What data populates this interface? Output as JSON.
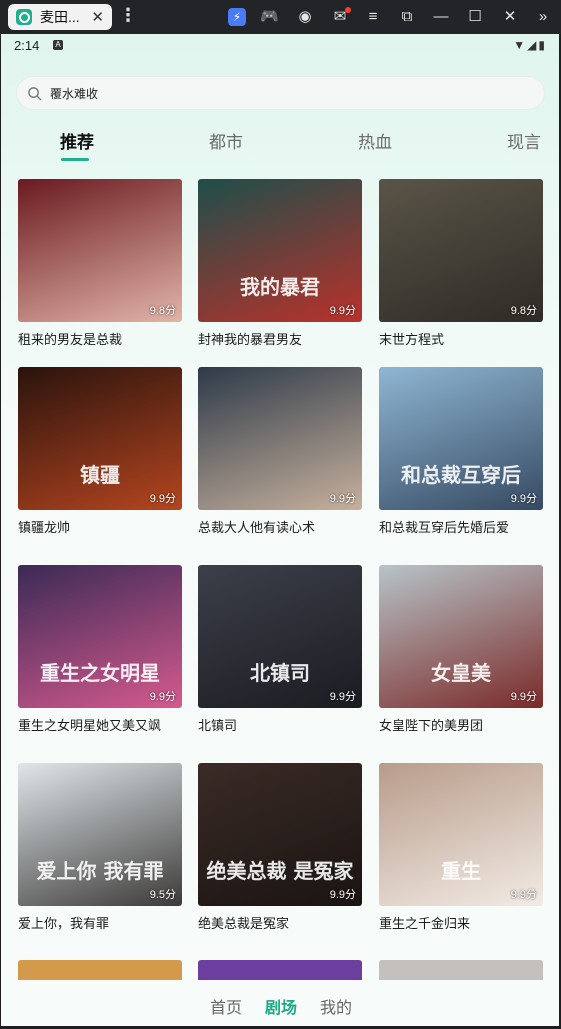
{
  "window": {
    "tab_title": "麦田...",
    "close_symbol": "✕",
    "menu_symbol": "⋮",
    "toolbar_icons": [
      "bolt-icon",
      "gamepad-icon",
      "user-icon",
      "mail-icon",
      "menu-icon",
      "external-icon",
      "minimize-icon",
      "maximize-icon",
      "close-icon",
      "chevron-right-icon"
    ],
    "toolbar_glyphs": [
      "⚡",
      "🎮",
      "◉",
      "✉",
      "≡",
      "⧉",
      "—",
      "☐",
      "✕",
      "»"
    ]
  },
  "status_bar": {
    "time": "2:14",
    "indicator": "A",
    "right_icons": "▼◢▮"
  },
  "search": {
    "text": "覆水难收"
  },
  "tabs": [
    {
      "label": "推荐",
      "active": true
    },
    {
      "label": "都市",
      "active": false
    },
    {
      "label": "热血",
      "active": false
    },
    {
      "label": "现言",
      "active": false
    }
  ],
  "cards": [
    {
      "title": "租来的男友是总裁",
      "score": "9.8分",
      "colors": [
        "#6a1a1f",
        "#e2b4a8"
      ],
      "poster": ""
    },
    {
      "title": "封神我的暴君男友",
      "score": "9.9分",
      "colors": [
        "#1f4e4a",
        "#b9312b"
      ],
      "poster": "我的暴君"
    },
    {
      "title": "末世方程式",
      "score": "9.8分",
      "colors": [
        "#5a5448",
        "#2f2b26"
      ],
      "poster": ""
    },
    {
      "title": "镇疆龙帅",
      "score": "9.9分",
      "colors": [
        "#2a130d",
        "#b5451f"
      ],
      "poster": "镇疆"
    },
    {
      "title": "总裁大人他有读心术",
      "score": "9.9分",
      "colors": [
        "#2e3a49",
        "#c7b19d"
      ],
      "poster": ""
    },
    {
      "title": "和总裁互穿后先婚后爱",
      "score": "9.9分",
      "colors": [
        "#8fb6d3",
        "#364a62"
      ],
      "poster": "和总裁互穿后"
    },
    {
      "title": "重生之女明星她又美又飒",
      "score": "9.9分",
      "colors": [
        "#3b2a55",
        "#d55a8e"
      ],
      "poster": "重生之女明星"
    },
    {
      "title": "北镇司",
      "score": "9.9分",
      "colors": [
        "#3d3f49",
        "#1b1c22"
      ],
      "poster": "北镇司"
    },
    {
      "title": "女皇陛下的美男团",
      "score": "9.9分",
      "colors": [
        "#b7c4c9",
        "#7b2a29"
      ],
      "poster": "女皇美"
    },
    {
      "title": "爱上你，我有罪",
      "score": "9.5分",
      "colors": [
        "#dfe6ea",
        "#3d3b39"
      ],
      "poster": "爱上你 我有罪"
    },
    {
      "title": "绝美总裁是冤家",
      "score": "9.9分",
      "colors": [
        "#3a2b26",
        "#1a1412"
      ],
      "poster": "绝美总裁 是冤家"
    },
    {
      "title": "重生之千金归来",
      "score": "9.9分",
      "colors": [
        "#b89c8a",
        "#f2ebe5"
      ],
      "poster": "重生"
    }
  ],
  "peek_colors": [
    "#d29a4a",
    "#6b3ea0",
    "#c4c0bd"
  ],
  "bottom_nav": [
    {
      "label": "首页",
      "active": false
    },
    {
      "label": "剧场",
      "active": true
    },
    {
      "label": "我的",
      "active": false
    }
  ]
}
